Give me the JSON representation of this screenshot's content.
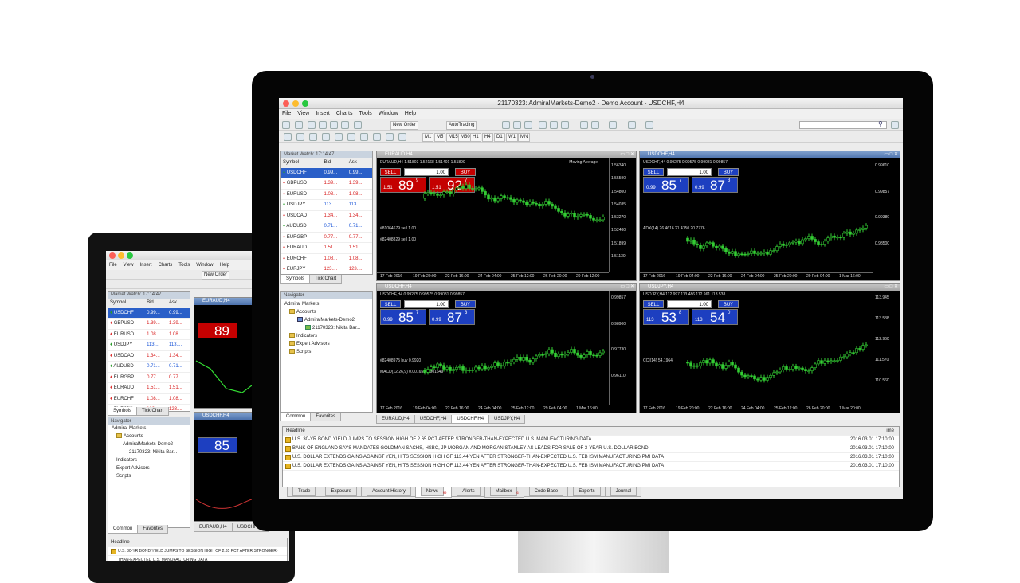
{
  "window_title": "21170323: AdmiralMarkets-Demo2 - Demo Account - USDCHF,H4",
  "menu": [
    "File",
    "View",
    "Insert",
    "Charts",
    "Tools",
    "Window",
    "Help"
  ],
  "toolbar": {
    "new_order": "New Order",
    "autotrading": "AutoTrading"
  },
  "timeframes": [
    "M1",
    "M5",
    "M15",
    "M30",
    "H1",
    "H4",
    "D1",
    "W1",
    "MN"
  ],
  "market_watch": {
    "title": "Market Watch: 17:14:47",
    "headers": [
      "Symbol",
      "Bid",
      "Ask"
    ],
    "rows": [
      {
        "symbol": "USDCHF",
        "bid": "0.99...",
        "ask": "0.99...",
        "dir": "up"
      },
      {
        "symbol": "GBPUSD",
        "bid": "1.39...",
        "ask": "1.39...",
        "dir": "dn"
      },
      {
        "symbol": "EURUSD",
        "bid": "1.08...",
        "ask": "1.08...",
        "dir": "dn"
      },
      {
        "symbol": "USDJPY",
        "bid": "113....",
        "ask": "113....",
        "dir": "up"
      },
      {
        "symbol": "USDCAD",
        "bid": "1.34...",
        "ask": "1.34...",
        "dir": "dn"
      },
      {
        "symbol": "AUDUSD",
        "bid": "0.71...",
        "ask": "0.71...",
        "dir": "up"
      },
      {
        "symbol": "EURGBP",
        "bid": "0.77...",
        "ask": "0.77...",
        "dir": "dn"
      },
      {
        "symbol": "EURAUD",
        "bid": "1.51...",
        "ask": "1.51...",
        "dir": "dn"
      },
      {
        "symbol": "EURCHF",
        "bid": "1.08...",
        "ask": "1.08...",
        "dir": "dn"
      },
      {
        "symbol": "EURJPY",
        "bid": "123....",
        "ask": "123....",
        "dir": "dn"
      }
    ],
    "tabs": [
      "Symbols",
      "Tick Chart"
    ]
  },
  "navigator": {
    "title": "Navigator",
    "items": [
      "Admiral Markets",
      "Accounts",
      "AdmiralMarkets-Demo2",
      "21170323: Nikita Bar...",
      "Indicators",
      "Expert Advisors",
      "Scripts"
    ],
    "tabs": [
      "Common",
      "Favorites"
    ]
  },
  "charts": [
    {
      "title": "EURAUD,H4",
      "info": "EURAUD,H4 1.51803 1.52168 1.51401 1.51899",
      "indicator": "Moving Average",
      "lot": "1.00",
      "sell_small": "1.51",
      "sell_big": "89",
      "sell_sup": "9",
      "buy_small": "1.51",
      "buy_big": "92",
      "buy_sup": "7",
      "color": "red",
      "sell": "SELL",
      "buy": "BUY",
      "dates": [
        "17 Feb 2016",
        "19 Feb 20:00",
        "22 Feb 16:00",
        "24 Feb 04:00",
        "25 Feb 12:00",
        "26 Feb 20:00",
        "29 Feb 12:00"
      ],
      "prices": [
        "1.56340",
        "1.55590",
        "1.54800",
        "1.54035",
        "1.53270",
        "1.52480",
        "1.51899",
        "1.51130"
      ],
      "notes": [
        "#81064679 sell 1.00",
        "#82408829 sell 1.00"
      ]
    },
    {
      "title": "USDCHF,H4",
      "info": "USDCHF,H4 0.99275 0.99575 0.99081 0.99857",
      "indicator": "",
      "lot": "1.00",
      "sell_small": "0.99",
      "sell_big": "85",
      "sell_sup": "7",
      "buy_small": "0.99",
      "buy_big": "87",
      "buy_sup": "3",
      "color": "blue",
      "sell": "SELL",
      "buy": "BUY",
      "dates": [
        "17 Feb 2016",
        "19 Feb 04:00",
        "22 Feb 16:00",
        "24 Feb 04:00",
        "25 Feb 20:00",
        "29 Feb 04:00",
        "1 Mar 16:00"
      ],
      "prices": [
        "0.99610",
        "0.99857",
        "0.99380",
        "0.98500"
      ],
      "notes": [
        "ADX(14) 26.4616 21.4150 20.7776"
      ]
    },
    {
      "title": "USDCHF,H4",
      "info": "USDCHF,H4 0.99275 0.99575 0.99081 0.99857",
      "indicator": "",
      "lot": "1.00",
      "sell_small": "0.99",
      "sell_big": "85",
      "sell_sup": "7",
      "buy_small": "0.99",
      "buy_big": "87",
      "buy_sup": "3",
      "color": "blue",
      "sell": "SELL",
      "buy": "BUY",
      "dates": [
        "17 Feb 2016",
        "19 Feb 04:00",
        "22 Feb 16:00",
        "24 Feb 04:00",
        "25 Feb 12:00",
        "29 Feb 04:00",
        "1 Mar 16:00"
      ],
      "prices": [
        "0.99857",
        "0.98900",
        "0.97730",
        "0.96110"
      ],
      "notes": [
        "#82408975 buy 0.9920",
        "MACD(12,26,9) 0.001653 0.001649"
      ]
    },
    {
      "title": "USDJPY,H4",
      "info": "USDJPY,H4 112.997 113.486 112.961 113.538",
      "indicator": "",
      "lot": "1.00",
      "sell_small": "113",
      "sell_big": "53",
      "sell_sup": "8",
      "buy_small": "113",
      "buy_big": "54",
      "buy_sup": "0",
      "color": "blue",
      "sell": "SELL",
      "buy": "BUY",
      "dates": [
        "17 Feb 2016",
        "19 Feb 20:00",
        "22 Feb 16:00",
        "24 Feb 04:00",
        "25 Feb 12:00",
        "26 Feb 20:00",
        "1 Mar 20:00"
      ],
      "prices": [
        "113.945",
        "113.538",
        "112.960",
        "111.570",
        "110.560"
      ],
      "notes": [
        "CCI(14) 54.1964"
      ]
    }
  ],
  "chart_tabs": [
    "EURAUD,H4",
    "USDCHF,H4",
    "USDCHF,H4",
    "USDJPY,H4"
  ],
  "news": {
    "headers": [
      "Headline",
      "Time"
    ],
    "rows": [
      {
        "headline": "U.S. 30-YR BOND YIELD JUMPS TO SESSION HIGH OF 2.65 PCT AFTER  STRONGER-THAN-EXPECTED U.S. MANUFACTURING DATA",
        "time": "2016.03.01 17:10:00"
      },
      {
        "headline": "BANK OF ENGLAND SAYS MANDATES GOLDMAN SACHS, HSBC, JP MORGAN AND MORGAN STANLEY AS LEADS FOR SALE OF 3-YEAR U.S. DOLLAR BOND",
        "time": "2016.03.01 17:10:00"
      },
      {
        "headline": "U.S. DOLLAR EXTENDS GAINS AGAINST YEN, HITS SESSION HIGH OF  113.44 YEN AFTER STRONGER-THAN-EXPECTED U.S. FEB ISM MANUFACTURING PMI DATA",
        "time": "2016.03.01 17:10:00"
      },
      {
        "headline": "U.S. DOLLAR EXTENDS GAINS AGAINST YEN, HITS SESSION HIGH OF 113.44 YEN AFTER STRONGER-THAN-EXPECTED U.S. FEB ISM MANUFACTURING PMI DATA",
        "time": "2016.03.01 17:10:00"
      }
    ]
  },
  "bottom_tabs": [
    "Trade",
    "Exposure",
    "Account History",
    "News",
    "Alerts",
    "Mailbox",
    "Code Base",
    "Experts",
    "Journal"
  ],
  "news_count": "99",
  "mailbox_count": "6",
  "laptop": {
    "menu": [
      "File",
      "View",
      "Insert",
      "Charts",
      "Tools",
      "Window",
      "Help"
    ],
    "new_order": "New Order",
    "mw_title": "Market Watch: 17:14:47",
    "chart1_title": "EURAUD,H4",
    "chart2_title": "USDCHF,H4",
    "chart3_title": "USDCHF,H4",
    "price1": "89",
    "price2": "85",
    "headline": "U.S. 30-YR BOND YIELD JUMPS TO SESSION HIGH OF 2.65 PCT AFTER  STRONGER-THAN-EXPECTED U.S. MANUFACTURING DATA",
    "tabs": [
      "Common",
      "Favorites"
    ],
    "chart_tabs": [
      "EURAUD,H4",
      "USDCHF,H4"
    ]
  }
}
